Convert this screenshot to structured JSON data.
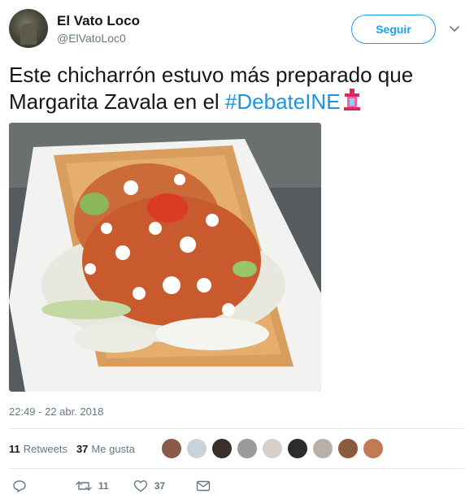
{
  "user": {
    "name": "El Vato Loco",
    "handle": "@ElVatoLoc0"
  },
  "follow_button": {
    "label": "Seguir"
  },
  "tweet": {
    "text": "Este chicharrón estuvo más preparado que Margarita Zavala en el ",
    "hashtag": "#DebateINE",
    "emoji_icon": "podium-icon"
  },
  "timestamp": "22:49 - 22 abr. 2018",
  "stats": {
    "retweets_count": "11",
    "retweets_label": "Retweets",
    "likes_count": "37",
    "likes_label": "Me gusta"
  },
  "likers": [
    {
      "color": "#8a5a4a"
    },
    {
      "color": "#c9d3dc"
    },
    {
      "color": "#3a2f2a"
    },
    {
      "color": "#9a9a9a"
    },
    {
      "color": "#d8d0c8"
    },
    {
      "color": "#2c2c2c"
    },
    {
      "color": "#b8b0a8"
    },
    {
      "color": "#8b5a3c"
    },
    {
      "color": "#c07a55"
    }
  ],
  "actions": {
    "reply_count": "",
    "retweet_count": "11",
    "like_count": "37"
  },
  "colors": {
    "accent": "#1da1f2",
    "hashtag": "#1b95e0",
    "secondary_text": "#657786"
  }
}
